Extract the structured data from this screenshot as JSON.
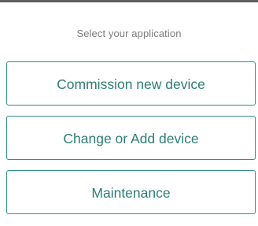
{
  "header": {
    "prompt": "Select your application"
  },
  "applications": [
    {
      "label": "Commission new device"
    },
    {
      "label": "Change or Add device"
    },
    {
      "label": "Maintenance"
    }
  ],
  "colors": {
    "accent": "#2e7d77",
    "border": "#2f8f88",
    "prompt_text": "#7b7b7b",
    "top_bar": "#5e5e5e"
  }
}
